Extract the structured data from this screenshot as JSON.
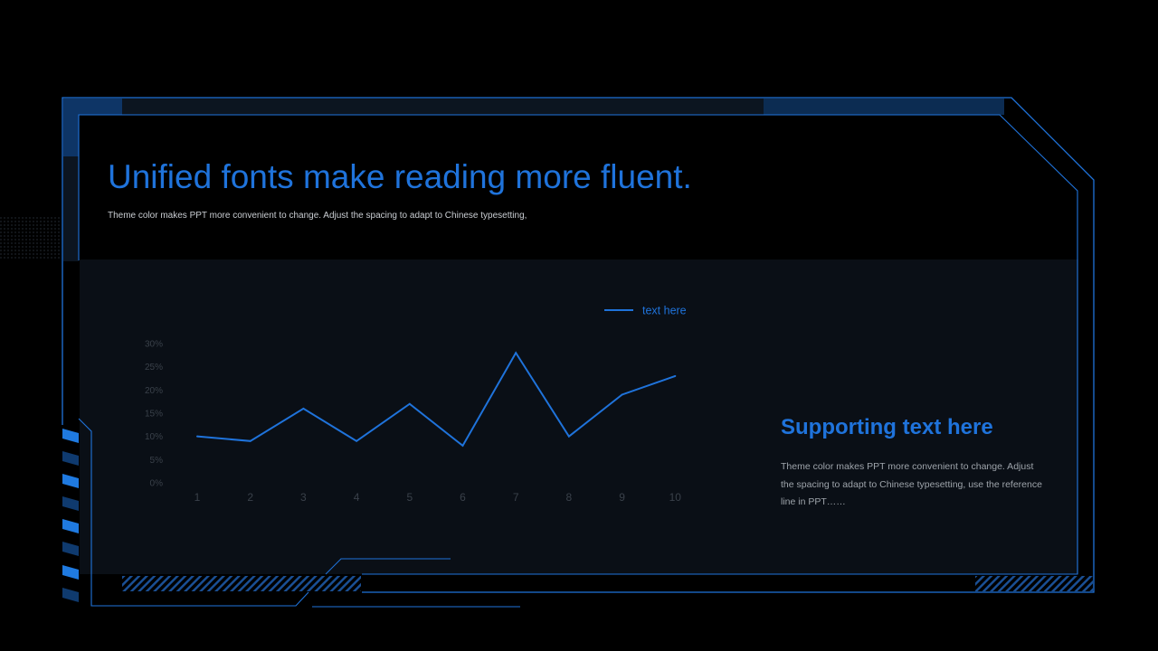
{
  "slide": {
    "title": "Unified fonts make reading more fluent.",
    "subtitle": "Theme color makes PPT more convenient to change. Adjust the spacing to adapt to Chinese typesetting,",
    "side_title": "Supporting text here",
    "side_body": "Theme color makes PPT more convenient to change. Adjust the spacing to adapt to Chinese typesetting, use the reference line in PPT……",
    "accent_color": "#1f73db",
    "background_color": "#000000",
    "panel_color": "#0a0f16"
  },
  "chart_data": {
    "type": "line",
    "x": [
      "1",
      "2",
      "3",
      "4",
      "5",
      "6",
      "7",
      "8",
      "9",
      "10"
    ],
    "y_ticks": [
      "0%",
      "5%",
      "10%",
      "15%",
      "20%",
      "25%",
      "30%"
    ],
    "ylim": [
      0,
      30
    ],
    "series": [
      {
        "name": "text here",
        "values": [
          10,
          9,
          16,
          9,
          17,
          8,
          28,
          10,
          19,
          23
        ],
        "color": "#1f73db"
      }
    ],
    "legend_position": "top-right",
    "grid": false
  }
}
